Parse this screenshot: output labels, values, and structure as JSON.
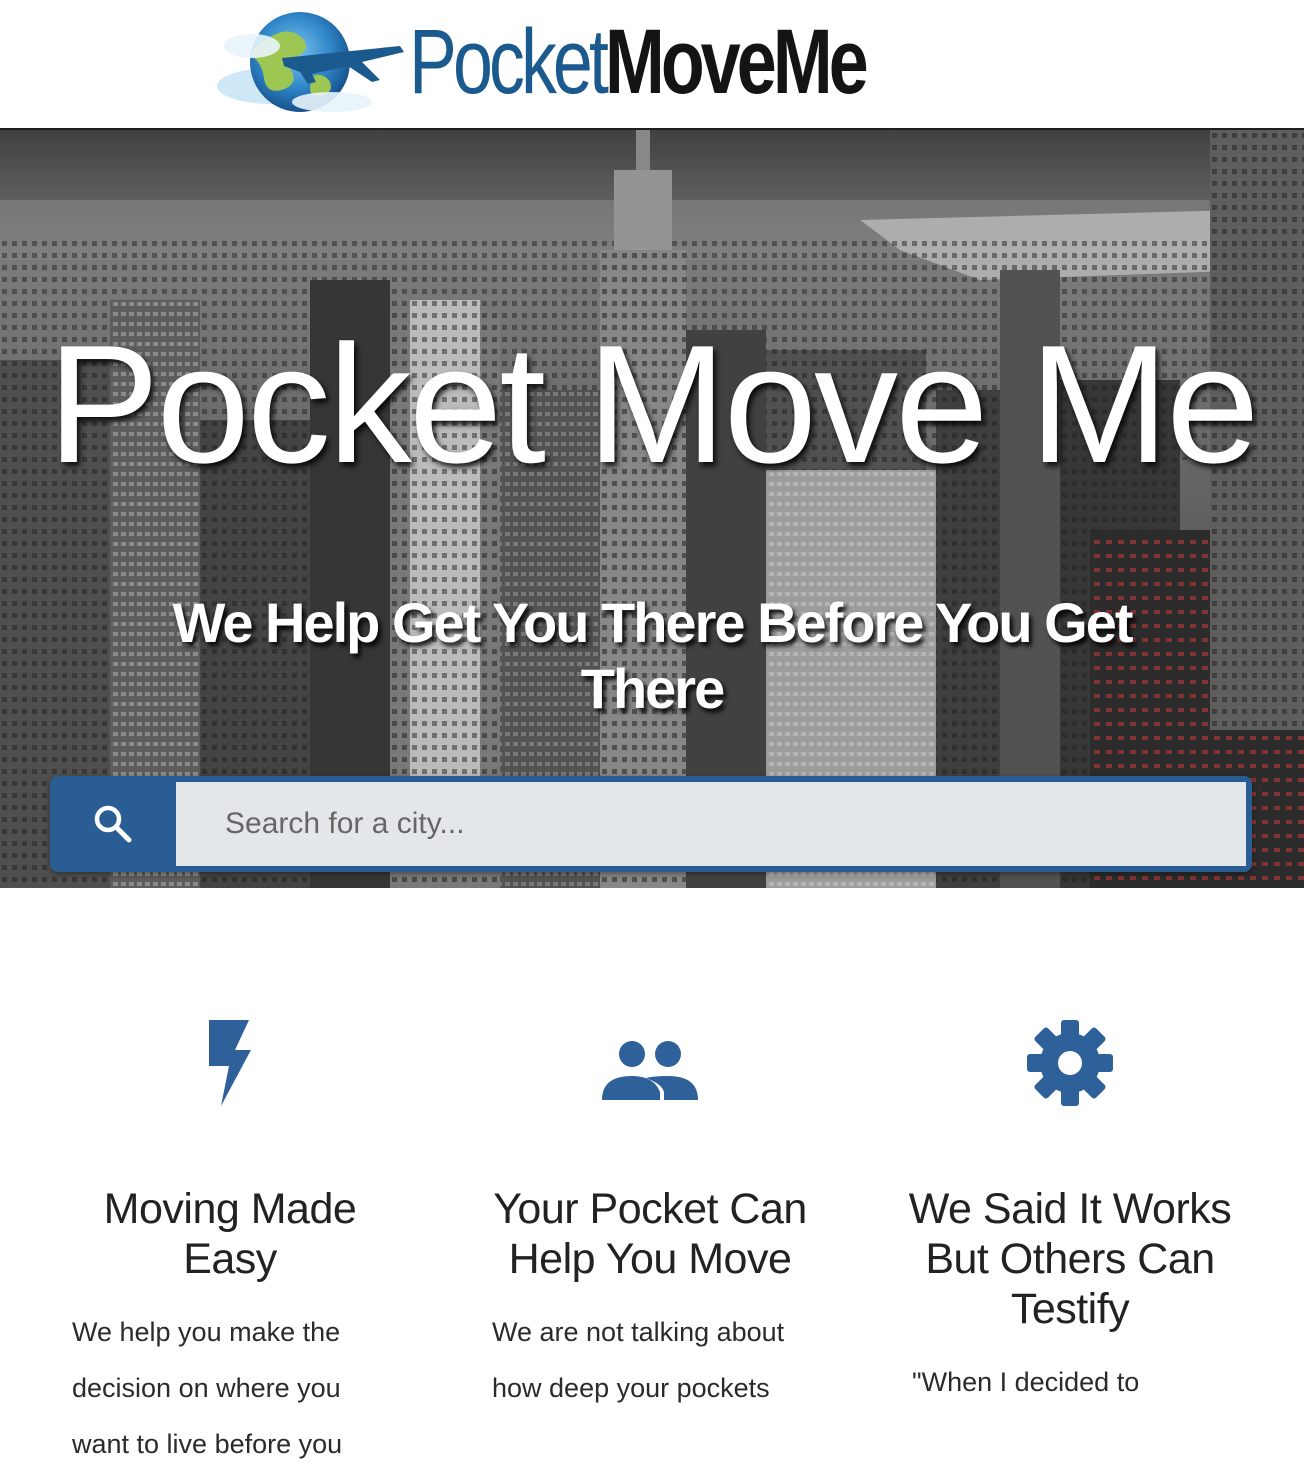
{
  "logo": {
    "part1": "Pocket",
    "part2": "MoveMe",
    "globe_icon": "globe-airplane-icon",
    "colors": {
      "pocket": "#1b5a8e",
      "moveme": "#141414"
    }
  },
  "hero": {
    "title": "Pocket Move Me",
    "subtitle": "We Help Get You There Before You Get There",
    "background": "grayscale-city-skyline"
  },
  "search": {
    "icon": "search-icon",
    "placeholder": "Search for a city...",
    "value": ""
  },
  "features": [
    {
      "icon": "lightning-bolt-icon",
      "title": "Moving Made Easy",
      "text": "We help you make the decision on where you want to live before you"
    },
    {
      "icon": "people-icon",
      "title": "Your Pocket Can Help You Move",
      "text": "We are not talking about how deep your pockets"
    },
    {
      "icon": "gear-icon",
      "title": "We Said It Works But Others Can Testify",
      "text": "\"When I decided to"
    }
  ],
  "colors": {
    "accent": "#2a5d93",
    "icon": "#2e619a"
  }
}
